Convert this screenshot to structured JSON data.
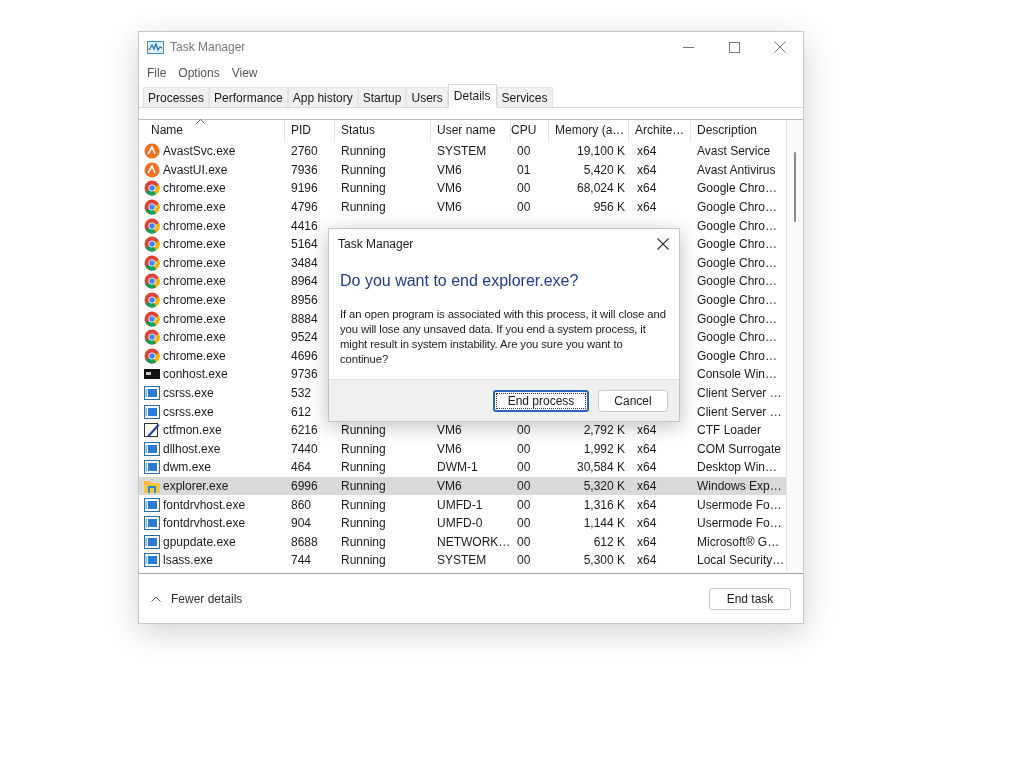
{
  "window": {
    "title": "Task Manager"
  },
  "menu": [
    "File",
    "Options",
    "View"
  ],
  "tabs": [
    {
      "label": "Processes",
      "selected": false
    },
    {
      "label": "Performance",
      "selected": false
    },
    {
      "label": "App history",
      "selected": false
    },
    {
      "label": "Startup",
      "selected": false
    },
    {
      "label": "Users",
      "selected": false
    },
    {
      "label": "Details",
      "selected": true
    },
    {
      "label": "Services",
      "selected": false
    }
  ],
  "table": {
    "columns": [
      "Name",
      "PID",
      "Status",
      "User name",
      "CPU",
      "Memory (a…",
      "Archite…",
      "Description"
    ],
    "rows": [
      {
        "kind": "avast",
        "name": "AvastSvc.exe",
        "pid": "2760",
        "status": "Running",
        "user": "SYSTEM",
        "cpu": "00",
        "memory": "19,100 K",
        "arch": "x64",
        "description": "Avast Service",
        "selected": false
      },
      {
        "kind": "avast",
        "name": "AvastUI.exe",
        "pid": "7936",
        "status": "Running",
        "user": "VM6",
        "cpu": "01",
        "memory": "5,420 K",
        "arch": "x64",
        "description": "Avast Antivirus",
        "selected": false
      },
      {
        "kind": "chrome",
        "name": "chrome.exe",
        "pid": "9196",
        "status": "Running",
        "user": "VM6",
        "cpu": "00",
        "memory": "68,024 K",
        "arch": "x64",
        "description": "Google Chro…",
        "selected": false
      },
      {
        "kind": "chrome",
        "name": "chrome.exe",
        "pid": "4796",
        "status": "Running",
        "user": "VM6",
        "cpu": "00",
        "memory": "956 K",
        "arch": "x64",
        "description": "Google Chro…",
        "selected": false
      },
      {
        "kind": "chrome",
        "name": "chrome.exe",
        "pid": "4416",
        "description": "Google Chro…",
        "selected": false
      },
      {
        "kind": "chrome",
        "name": "chrome.exe",
        "pid": "5164",
        "description": "Google Chro…",
        "selected": false
      },
      {
        "kind": "chrome",
        "name": "chrome.exe",
        "pid": "3484",
        "description": "Google Chro…",
        "selected": false
      },
      {
        "kind": "chrome",
        "name": "chrome.exe",
        "pid": "8964",
        "description": "Google Chro…",
        "selected": false
      },
      {
        "kind": "chrome",
        "name": "chrome.exe",
        "pid": "8956",
        "description": "Google Chro…",
        "selected": false
      },
      {
        "kind": "chrome",
        "name": "chrome.exe",
        "pid": "8884",
        "description": "Google Chro…",
        "selected": false
      },
      {
        "kind": "chrome",
        "name": "chrome.exe",
        "pid": "9524",
        "description": "Google Chro…",
        "selected": false
      },
      {
        "kind": "chrome",
        "name": "chrome.exe",
        "pid": "4696",
        "description": "Google Chro…",
        "selected": false
      },
      {
        "kind": "console",
        "name": "conhost.exe",
        "pid": "9736",
        "description": "Console Win…",
        "selected": false
      },
      {
        "kind": "app",
        "name": "csrss.exe",
        "pid": "532",
        "description": "Client Server …",
        "selected": false
      },
      {
        "kind": "app",
        "name": "csrss.exe",
        "pid": "612",
        "description": "Client Server …",
        "selected": false
      },
      {
        "kind": "pen",
        "name": "ctfmon.exe",
        "pid": "6216",
        "status": "Running",
        "user": "VM6",
        "cpu": "00",
        "memory": "2,792 K",
        "arch": "x64",
        "description": "CTF Loader",
        "selected": false
      },
      {
        "kind": "app",
        "name": "dllhost.exe",
        "pid": "7440",
        "status": "Running",
        "user": "VM6",
        "cpu": "00",
        "memory": "1,992 K",
        "arch": "x64",
        "description": "COM Surrogate",
        "selected": false
      },
      {
        "kind": "app",
        "name": "dwm.exe",
        "pid": "464",
        "status": "Running",
        "user": "DWM-1",
        "cpu": "00",
        "memory": "30,584 K",
        "arch": "x64",
        "description": "Desktop Win…",
        "selected": false
      },
      {
        "kind": "folder",
        "name": "explorer.exe",
        "pid": "6996",
        "status": "Running",
        "user": "VM6",
        "cpu": "00",
        "memory": "5,320 K",
        "arch": "x64",
        "description": "Windows Exp…",
        "selected": true
      },
      {
        "kind": "app",
        "name": "fontdrvhost.exe",
        "pid": "860",
        "status": "Running",
        "user": "UMFD-1",
        "cpu": "00",
        "memory": "1,316 K",
        "arch": "x64",
        "description": "Usermode Fo…",
        "selected": false
      },
      {
        "kind": "app",
        "name": "fontdrvhost.exe",
        "pid": "904",
        "status": "Running",
        "user": "UMFD-0",
        "cpu": "00",
        "memory": "1,144 K",
        "arch": "x64",
        "description": "Usermode Fo…",
        "selected": false
      },
      {
        "kind": "app",
        "name": "gpupdate.exe",
        "pid": "8688",
        "status": "Running",
        "user": "NETWORK…",
        "cpu": "00",
        "memory": "612 K",
        "arch": "x64",
        "description": "Microsoft® G…",
        "selected": false
      },
      {
        "kind": "app",
        "name": "lsass.exe",
        "pid": "744",
        "status": "Running",
        "user": "SYSTEM",
        "cpu": "00",
        "memory": "5,300 K",
        "arch": "x64",
        "description": "Local Security…",
        "selected": false
      }
    ]
  },
  "footer": {
    "toggle": "Fewer details",
    "button": "End task"
  },
  "dialog": {
    "title": "Task Manager",
    "heading": "Do you want to end explorer.exe?",
    "message": "If an open program is associated with this process, it will close and you will lose any unsaved data. If you end a system process, it might result in system instability. Are you sure you want to continue?",
    "buttons": [
      "End process",
      "Cancel"
    ]
  }
}
